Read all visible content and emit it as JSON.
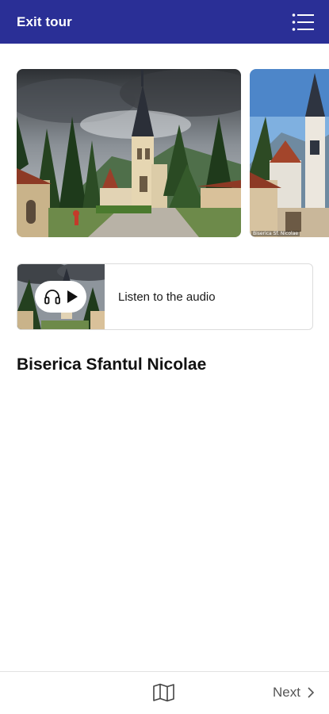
{
  "header": {
    "exit_label": "Exit tour",
    "menu_icon": "list-menu-icon",
    "background_color": "#2a2f96"
  },
  "gallery": {
    "images": [
      {
        "description_icon": "church-photo",
        "credit": ""
      },
      {
        "description_icon": "church-photo",
        "credit": "Biserica Sf. Nicolae"
      }
    ]
  },
  "audio": {
    "label": "Listen to the audio",
    "icons": [
      "headphones-icon",
      "play-icon"
    ]
  },
  "stop": {
    "title": "Biserica Sfantul Nicolae"
  },
  "footer": {
    "map_icon": "map-icon",
    "next_label": "Next",
    "next_icon": "chevron-right-icon"
  }
}
